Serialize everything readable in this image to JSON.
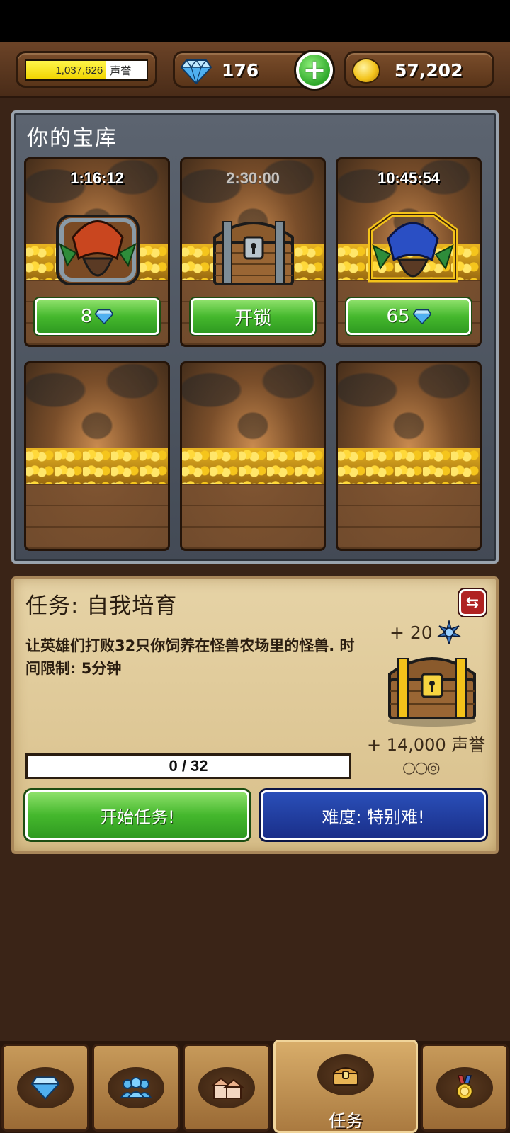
{
  "topbar": {
    "reputation": {
      "value": "1,037,626",
      "label": "声誉",
      "fill_fraction": 0.66
    },
    "gems": {
      "count": "176",
      "icon": "diamond-icon"
    },
    "add_button_icon": "plus-icon",
    "gold": {
      "count": "57,202",
      "icon": "gold-coin-icon"
    }
  },
  "vault": {
    "title": "你的宝库",
    "slots": [
      {
        "timer": "1:16:12",
        "button": {
          "label": "8",
          "icon": "diamond-icon"
        },
        "chest": "monster-chest-red"
      },
      {
        "timer": "2:30:00",
        "button": {
          "label": "开锁"
        },
        "chest": "wooden-chest"
      },
      {
        "timer": "10:45:54",
        "button": {
          "label": "65",
          "icon": "diamond-icon"
        },
        "chest": "monster-chest-blue"
      },
      {
        "timer": "",
        "button": null,
        "chest": null
      },
      {
        "timer": "",
        "button": null,
        "chest": null
      },
      {
        "timer": "",
        "button": null,
        "chest": null
      }
    ]
  },
  "quest": {
    "title": "任务: 自我培育",
    "description": "让英雄们打败32只你饲养在怪兽农场里的怪兽. 时间限制: 5分钟",
    "reward_shards": "+ 20",
    "reward_reputation": "+ 14,000 声誉",
    "difficulty_dots": "○○◎",
    "progress": {
      "current": 0,
      "total": 32,
      "text": "0 / 32"
    },
    "start_button": "开始任务!",
    "difficulty_button": "难度: 特别难!"
  },
  "nav": {
    "tabs": [
      {
        "icon": "gems-icon",
        "label": ""
      },
      {
        "icon": "heroes-icon",
        "label": ""
      },
      {
        "icon": "buildings-icon",
        "label": ""
      },
      {
        "icon": "treasure-chest-icon",
        "label": "任务",
        "active": true
      },
      {
        "icon": "medal-icon",
        "label": ""
      }
    ]
  },
  "colors": {
    "accent_green": "#45b82d",
    "accent_blue": "#1a2f8a",
    "wood_brown": "#5a3519"
  }
}
